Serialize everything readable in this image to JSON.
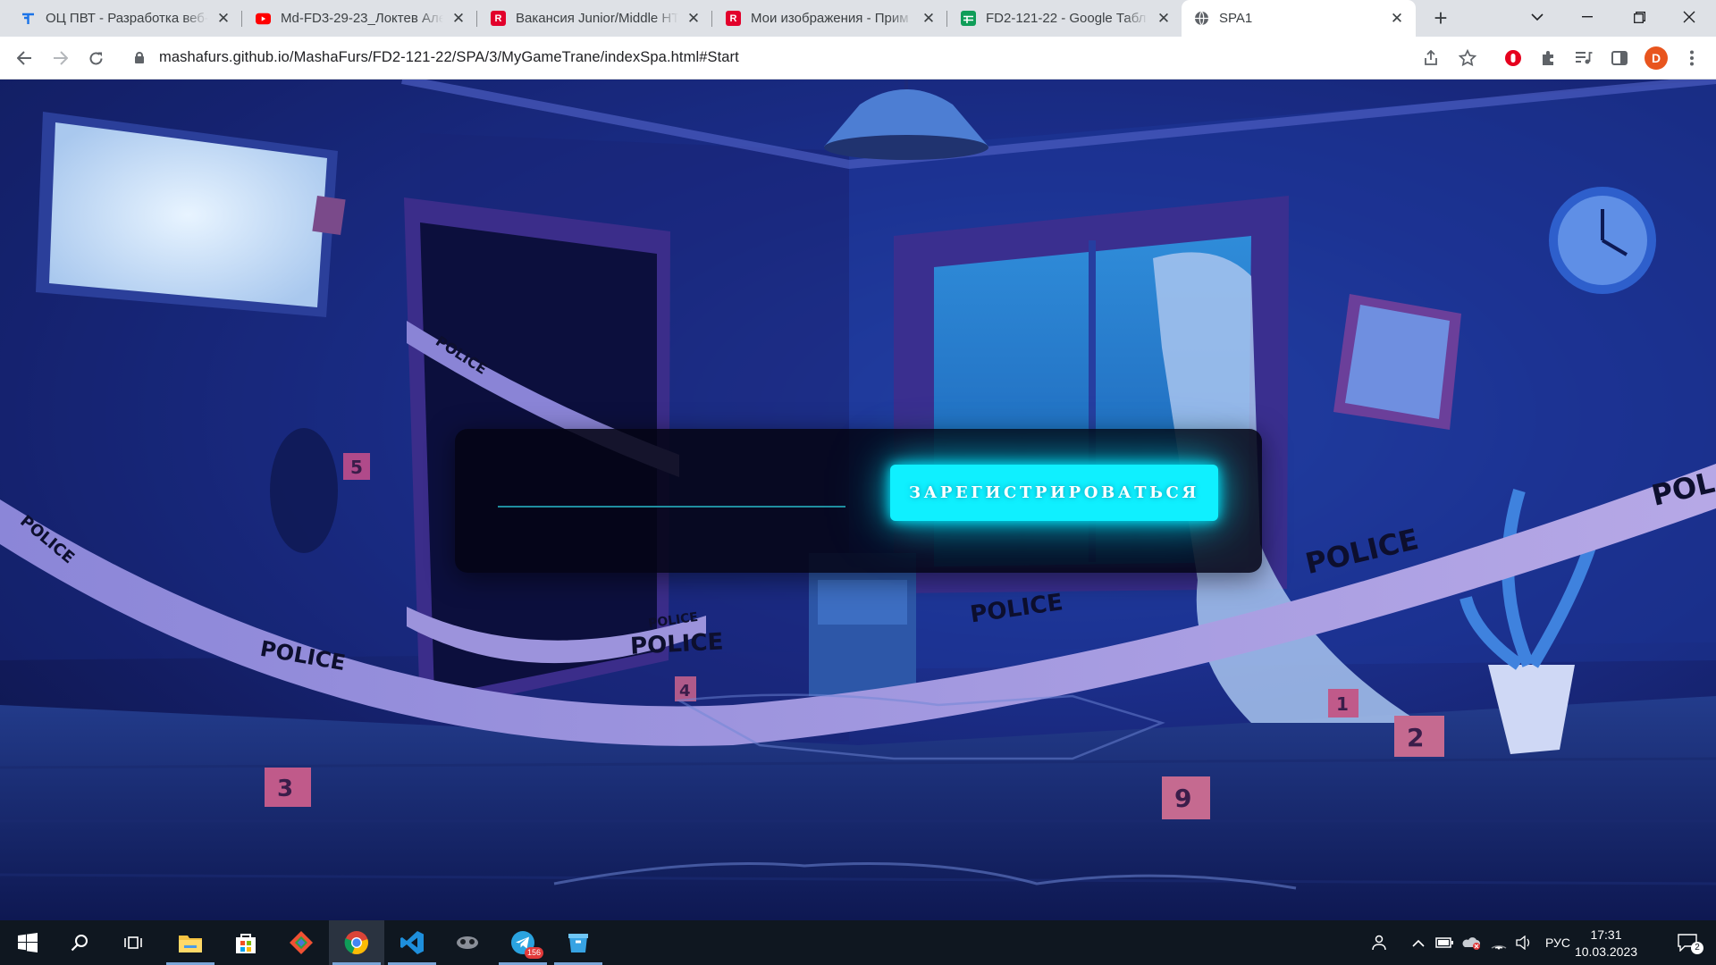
{
  "browser": {
    "tabs": [
      {
        "title": "ОЦ ПВТ - Разработка веб-",
        "favicon": "pvt-logo-icon",
        "color": "#1a73e8",
        "active": false
      },
      {
        "title": "Md-FD3-29-23_Локтев Але",
        "favicon": "youtube-icon",
        "color": "#ff0000",
        "active": false
      },
      {
        "title": "Вакансия Junior/Middle HT",
        "favicon": "rabota-logo-icon",
        "color": "#e2002b",
        "active": false
      },
      {
        "title": "Мои изображения - Прим",
        "favicon": "rabota-logo-icon",
        "color": "#e2002b",
        "active": false
      },
      {
        "title": "FD2-121-22 - Google Табл",
        "favicon": "google-sheets-icon",
        "color": "#0f9d58",
        "active": false
      },
      {
        "title": "SPA1",
        "favicon": "globe-icon",
        "color": "#5f6368",
        "active": true
      }
    ],
    "url": "mashafurs.github.io/MashaFurs/FD2-121-22/SPA/3/MyGameTrane/indexSpa.html#Start",
    "profile_initial": "D"
  },
  "page": {
    "name_input": {
      "value": "",
      "placeholder": ""
    },
    "register_button": "ЗАРЕГИСТРИРОВАТЬСЯ"
  },
  "taskbar": {
    "apps": [
      "start-icon",
      "search-icon",
      "task-view-icon",
      "file-explorer-icon",
      "store-icon",
      "git-icon",
      "chrome-icon",
      "vscode-icon",
      "app-icon",
      "telegram-icon",
      "paint-icon"
    ],
    "telegram_badge": "156",
    "language": "РУС",
    "time": "17:31",
    "date": "10.03.2023",
    "notifications": "2"
  }
}
